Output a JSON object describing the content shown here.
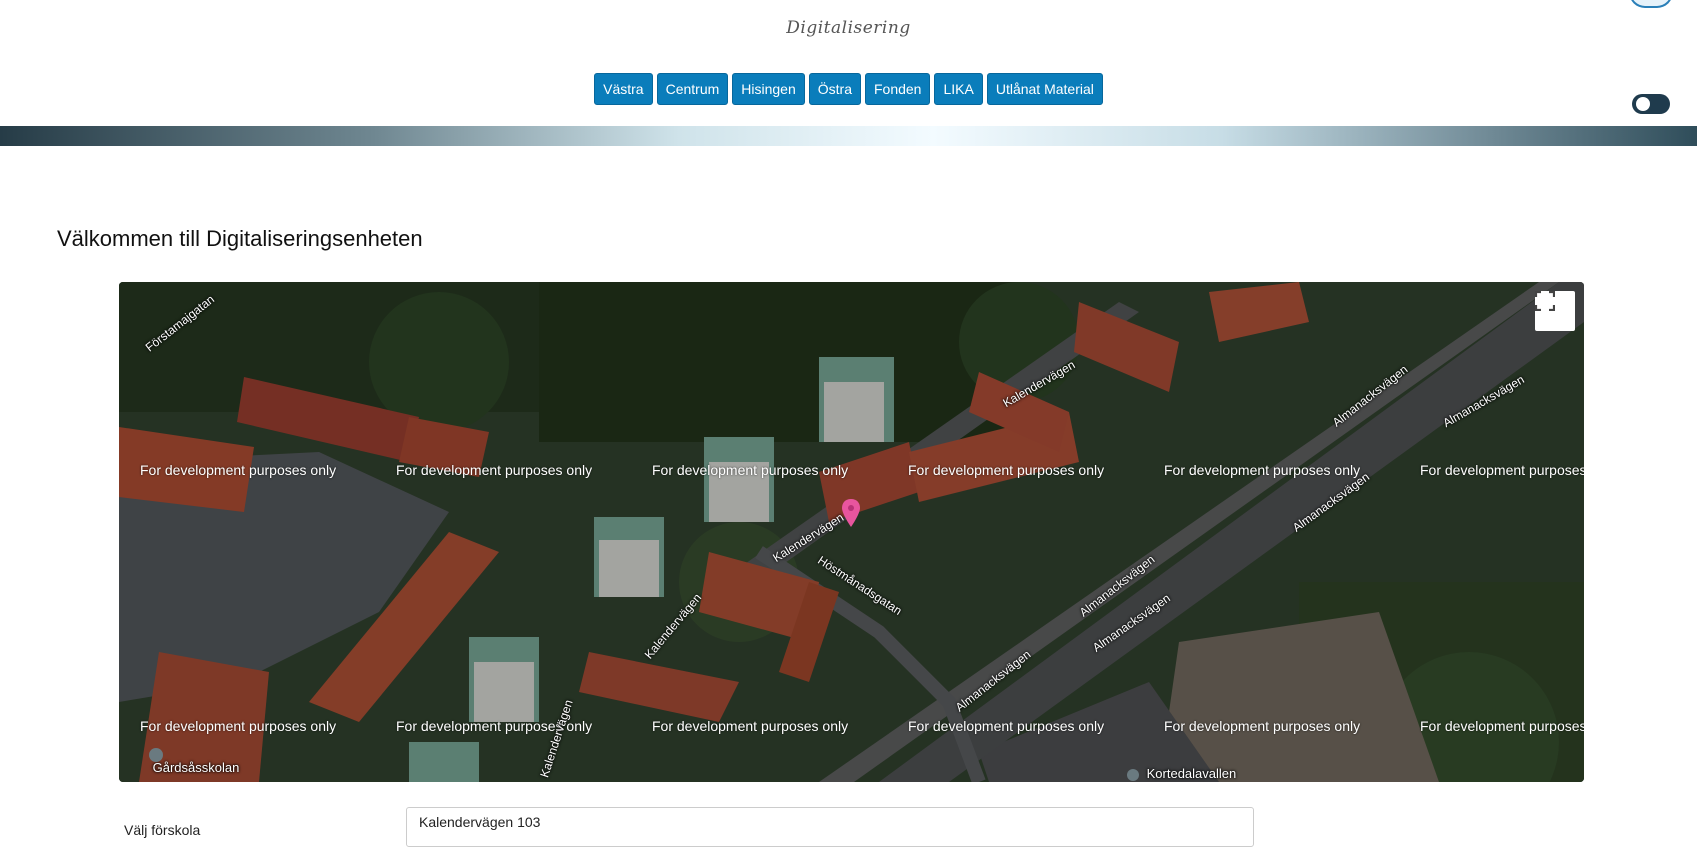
{
  "header": {
    "brand": "Digitalisering",
    "nav": [
      "Västra",
      "Centrum",
      "Hisingen",
      "Östra",
      "Fonden",
      "LIKA",
      "Utlånat Material"
    ]
  },
  "main": {
    "title": "Välkommen till Digitaliseringsenheten"
  },
  "map": {
    "watermark": "For development purposes only",
    "streets": [
      "Förstamajgatan",
      "Kalendervägen",
      "Almanacksvägen",
      "Höstmånadsgatan"
    ],
    "pois": [
      "Gårdsåsskolan",
      "Kortedalavallen"
    ],
    "marker_color": "#e8559e"
  },
  "form": {
    "label": "Välj förskola",
    "value": "Kalendervägen 103"
  },
  "colors": {
    "nav_button": "#0a7dbb",
    "toggle": "#1f3b4d"
  }
}
